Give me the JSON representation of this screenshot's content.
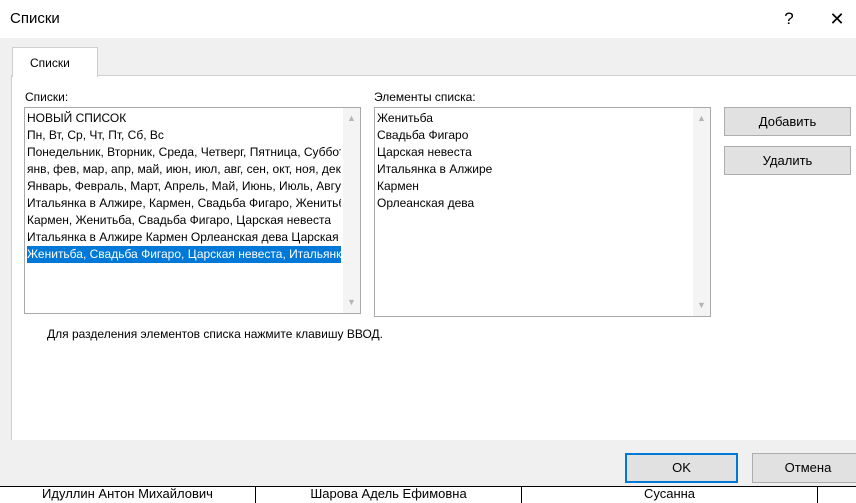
{
  "window": {
    "title": "Списки",
    "help_glyph": "?",
    "close_glyph": "✕"
  },
  "tabs": [
    {
      "label": "Списки"
    }
  ],
  "lists_panel": {
    "label": "Списки:",
    "items": [
      "НОВЫЙ СПИСОК",
      "Пн, Вт, Ср, Чт, Пт, Сб, Вс",
      "Понедельник, Вторник, Среда, Четверг, Пятница, Суббота, Воскресенье",
      "янв, фев, мар, апр, май, июн, июл, авг, сен, окт, ноя, дек",
      "Январь, Февраль, Март, Апрель, Май, Июнь, Июль, Август",
      "Итальянка в Алжире, Кармен, Свадьба Фигаро, Женитьба",
      "Кармен, Женитьба, Свадьба Фигаро, Царская невеста",
      "Итальянка в Алжире Кармен Орлеанская дева Царская невеста",
      "Женитьба, Свадьба Фигаро, Царская невеста, Итальянка в Алжире"
    ],
    "selected_index": 8
  },
  "elements_panel": {
    "label": "Элементы списка:",
    "items": [
      "Женитьба",
      "Свадьба Фигаро",
      "Царская невеста",
      "Итальянка в Алжире",
      "Кармен",
      "Орлеанская дева"
    ]
  },
  "buttons": {
    "add": "Добавить",
    "delete": "Удалить",
    "ok": "OK",
    "cancel": "Отмена"
  },
  "hint": "Для разделения элементов списка нажмите клавишу ВВОД.",
  "background_cells": [
    "Идуллин Антон Михайлович",
    "Шарова Адель Ефимовна",
    "Сусанна"
  ]
}
